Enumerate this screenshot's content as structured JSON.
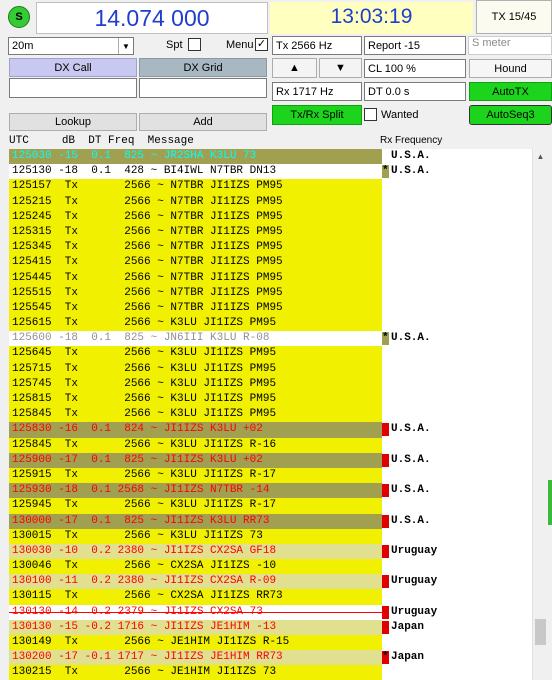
{
  "header": {
    "status_icon": "S",
    "dial_frequency": "14.074 000",
    "utc_time": "13:03:19",
    "tx_counter": "TX 15/45"
  },
  "controls": {
    "band": "20m",
    "spt_label": "Spt",
    "menu_label": "Menu",
    "menu_checked": "✓",
    "dx_call_label": "DX Call",
    "dx_grid_label": "DX Grid",
    "dx_call_value": "",
    "dx_grid_value": "",
    "lookup_label": "Lookup",
    "add_label": "Add",
    "tx_hz": "Tx  2566  Hz",
    "rx_hz": "Rx  1717  Hz",
    "report": "Report -15",
    "s_meter": "S meter",
    "up_arrow": "▲",
    "down_arrow": "▼",
    "cl_percent": "CL  100 %",
    "dt_value": "DT 0.0 s",
    "hound_label": "Hound",
    "autotx_label": "AutoTX",
    "split_label": "Tx/Rx Split",
    "wanted_label": "Wanted",
    "autoseq_label": "AutoSeq3"
  },
  "decoder": {
    "columns": [
      "UTC",
      "dB",
      "DT",
      "Freq",
      "Message"
    ],
    "rx_frequency_header": "Rx Frequency",
    "rows": [
      {
        "text": "125030 -15  0.1  825 ~ JR2SHA K3LU 73",
        "bg": "#a0a050",
        "fg": "#00ffff",
        "strike": false
      },
      {
        "text": "125130 -18  0.1  428 ~ BI4IWL N7TBR DN13",
        "bg": "#ffffff",
        "fg": "#000000",
        "strike": false
      },
      {
        "text": "125157  Tx       2566 ~ N7TBR JI1IZS PM95",
        "bg": "#f0f000",
        "fg": "#000000",
        "strike": false
      },
      {
        "text": "125215  Tx       2566 ~ N7TBR JI1IZS PM95",
        "bg": "#f0f000",
        "fg": "#000000",
        "strike": false
      },
      {
        "text": "125245  Tx       2566 ~ N7TBR JI1IZS PM95",
        "bg": "#f0f000",
        "fg": "#000000",
        "strike": false
      },
      {
        "text": "125315  Tx       2566 ~ N7TBR JI1IZS PM95",
        "bg": "#f0f000",
        "fg": "#000000",
        "strike": false
      },
      {
        "text": "125345  Tx       2566 ~ N7TBR JI1IZS PM95",
        "bg": "#f0f000",
        "fg": "#000000",
        "strike": false
      },
      {
        "text": "125415  Tx       2566 ~ N7TBR JI1IZS PM95",
        "bg": "#f0f000",
        "fg": "#000000",
        "strike": false
      },
      {
        "text": "125445  Tx       2566 ~ N7TBR JI1IZS PM95",
        "bg": "#f0f000",
        "fg": "#000000",
        "strike": false
      },
      {
        "text": "125515  Tx       2566 ~ N7TBR JI1IZS PM95",
        "bg": "#f0f000",
        "fg": "#000000",
        "strike": false
      },
      {
        "text": "125545  Tx       2566 ~ N7TBR JI1IZS PM95",
        "bg": "#f0f000",
        "fg": "#000000",
        "strike": false
      },
      {
        "text": "125615  Tx       2566 ~ K3LU JI1IZS PM95",
        "bg": "#f0f000",
        "fg": "#000000",
        "strike": false
      },
      {
        "text": "125600 -18  0.1  825 ~ JN6III K3LU R-08",
        "bg": "#ffffff",
        "fg": "#909090",
        "strike": false
      },
      {
        "text": "125645  Tx       2566 ~ K3LU JI1IZS PM95",
        "bg": "#f0f000",
        "fg": "#000000",
        "strike": false
      },
      {
        "text": "125715  Tx       2566 ~ K3LU JI1IZS PM95",
        "bg": "#f0f000",
        "fg": "#000000",
        "strike": false
      },
      {
        "text": "125745  Tx       2566 ~ K3LU JI1IZS PM95",
        "bg": "#f0f000",
        "fg": "#000000",
        "strike": false
      },
      {
        "text": "125815  Tx       2566 ~ K3LU JI1IZS PM95",
        "bg": "#f0f000",
        "fg": "#000000",
        "strike": false
      },
      {
        "text": "125845  Tx       2566 ~ K3LU JI1IZS PM95",
        "bg": "#f0f000",
        "fg": "#000000",
        "strike": false
      },
      {
        "text": "125830 -16  0.1  824 ~ JI1IZS K3LU +02",
        "bg": "#a0a050",
        "fg": "#ff0000",
        "strike": false
      },
      {
        "text": "125845  Tx       2566 ~ K3LU JI1IZS R-16",
        "bg": "#f0f000",
        "fg": "#000000",
        "strike": false
      },
      {
        "text": "125900 -17  0.1  825 ~ JI1IZS K3LU +02",
        "bg": "#a0a050",
        "fg": "#ff0000",
        "strike": false
      },
      {
        "text": "125915  Tx       2566 ~ K3LU JI1IZS R-17",
        "bg": "#f0f000",
        "fg": "#000000",
        "strike": false
      },
      {
        "text": "125930 -18  0.1 2568 ~ JI1IZS N7TBR -14",
        "bg": "#a0a050",
        "fg": "#ff0000",
        "strike": false
      },
      {
        "text": "125945  Tx       2566 ~ K3LU JI1IZS R-17",
        "bg": "#f0f000",
        "fg": "#000000",
        "strike": false
      },
      {
        "text": "130000 -17  0.1  825 ~ JI1IZS K3LU RR73",
        "bg": "#a0a050",
        "fg": "#ff0000",
        "strike": false
      },
      {
        "text": "130015  Tx       2566 ~ K3LU JI1IZS 73",
        "bg": "#f0f000",
        "fg": "#000000",
        "strike": false
      },
      {
        "text": "130030 -10  0.2 2380 ~ JI1IZS CX2SA GF18",
        "bg": "#e0e090",
        "fg": "#ff0000",
        "strike": false
      },
      {
        "text": "130046  Tx       2566 ~ CX2SA JI1IZS -10",
        "bg": "#f0f000",
        "fg": "#000000",
        "strike": false
      },
      {
        "text": "130100 -11  0.2 2380 ~ JI1IZS CX2SA R-09",
        "bg": "#e0e090",
        "fg": "#ff0000",
        "strike": false
      },
      {
        "text": "130115  Tx       2566 ~ CX2SA JI1IZS RR73",
        "bg": "#f0f000",
        "fg": "#000000",
        "strike": false
      },
      {
        "text": "130130 -14  0.2 2379 ~ JI1IZS CX2SA 73",
        "bg": "#ffffff",
        "fg": "#ff0000",
        "strike": true
      },
      {
        "text": "130130 -15 -0.2 1716 ~ JI1IZS JE1HIM -13",
        "bg": "#e0e090",
        "fg": "#ff0000",
        "strike": false
      },
      {
        "text": "130149  Tx       2566 ~ JE1HIM JI1IZS R-15",
        "bg": "#f0f000",
        "fg": "#000000",
        "strike": false
      },
      {
        "text": "130200 -17 -0.1 1717 ~ JI1IZS JE1HIM RR73",
        "bg": "#e0e090",
        "fg": "#ff0000",
        "strike": false
      },
      {
        "text": "130215  Tx       2566 ~ JE1HIM JI1IZS 73",
        "bg": "#f0f000",
        "fg": "#000000",
        "strike": false
      }
    ],
    "rx_rows": [
      {
        "mark": "none",
        "text": "U.S.A."
      },
      {
        "mark": "asterisk",
        "text": "U.S.A."
      },
      {
        "mark": "none",
        "text": ""
      },
      {
        "mark": "none",
        "text": ""
      },
      {
        "mark": "none",
        "text": ""
      },
      {
        "mark": "none",
        "text": ""
      },
      {
        "mark": "none",
        "text": ""
      },
      {
        "mark": "none",
        "text": ""
      },
      {
        "mark": "none",
        "text": ""
      },
      {
        "mark": "none",
        "text": ""
      },
      {
        "mark": "none",
        "text": ""
      },
      {
        "mark": "none",
        "text": ""
      },
      {
        "mark": "asterisk",
        "text": "U.S.A."
      },
      {
        "mark": "none",
        "text": ""
      },
      {
        "mark": "none",
        "text": ""
      },
      {
        "mark": "none",
        "text": ""
      },
      {
        "mark": "none",
        "text": ""
      },
      {
        "mark": "none",
        "text": ""
      },
      {
        "mark": "red",
        "text": "U.S.A."
      },
      {
        "mark": "none",
        "text": ""
      },
      {
        "mark": "red",
        "text": "U.S.A."
      },
      {
        "mark": "none",
        "text": ""
      },
      {
        "mark": "red",
        "text": "U.S.A."
      },
      {
        "mark": "none",
        "text": ""
      },
      {
        "mark": "red",
        "text": "U.S.A."
      },
      {
        "mark": "none",
        "text": ""
      },
      {
        "mark": "red",
        "text": "Uruguay"
      },
      {
        "mark": "none",
        "text": ""
      },
      {
        "mark": "red",
        "text": "Uruguay"
      },
      {
        "mark": "none",
        "text": ""
      },
      {
        "mark": "red",
        "text": "Uruguay"
      },
      {
        "mark": "red",
        "text": "Japan"
      },
      {
        "mark": "none",
        "text": ""
      },
      {
        "mark": "redasterisk",
        "text": "Japan"
      },
      {
        "mark": "none",
        "text": ""
      }
    ]
  },
  "colors": {
    "accent_green": "#1cd41c",
    "tx_yellow": "#f0f000",
    "frequency_blue": "#1f3ecb",
    "dx_call_lavender": "#c8c8f0"
  }
}
